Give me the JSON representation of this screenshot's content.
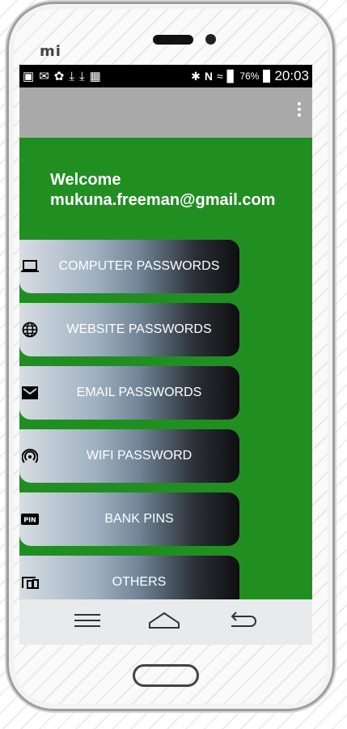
{
  "device": {
    "brand": "mi"
  },
  "status_bar": {
    "battery_pct": "76%",
    "time": "20:03"
  },
  "welcome": {
    "line1": "Welcome",
    "email": "mukuna.freeman@gmail.com"
  },
  "menu": [
    {
      "label": "COMPUTER PASSWORDS",
      "icon": "laptop-icon"
    },
    {
      "label": "WEBSITE PASSWORDS",
      "icon": "globe-icon"
    },
    {
      "label": "EMAIL PASSWORDS",
      "icon": "mail-icon"
    },
    {
      "label": "WIFI PASSWORD",
      "icon": "wifi-tethering-icon"
    },
    {
      "label": "BANK PINS",
      "icon": "pin-icon"
    },
    {
      "label": "OTHERS",
      "icon": "devices-icon"
    }
  ],
  "colors": {
    "content_bg": "#218e22",
    "appbar_bg": "#a9a9a9",
    "statusbar_bg": "#000000"
  }
}
